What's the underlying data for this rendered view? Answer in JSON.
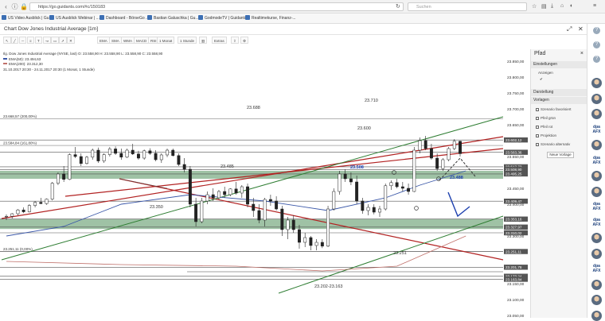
{
  "browser": {
    "url": "https://go.guidants.com/#c/150183",
    "search_placeholder": "Suchen"
  },
  "bookmarks": [
    {
      "label": "US Video Ausblick | Gu..."
    },
    {
      "label": "US Ausblick Webinar | ..."
    },
    {
      "label": "Dashboard - BörseGo ..."
    },
    {
      "label": "Bastian Galuschka | Gu..."
    },
    {
      "label": "GodmodeTV | Guidants"
    },
    {
      "label": "Realtimekurse, Finanz-..."
    }
  ],
  "chart_window": {
    "title": "Chart Dow Jones Industrial Average [1m]"
  },
  "toolbar": {
    "buttons": [
      "EMA",
      "SMA",
      "WMA",
      "MACD",
      "RSI",
      "1 Monat",
      "1 Stunde",
      "Extras"
    ]
  },
  "legend": {
    "line1": "Ilg. Dow Jones Industrial Average (NYSE, last) O: 23.558,90  H: 23.558,90  L: 23.558,90  C: 23.558,90",
    "line2": "EMA(50): 23.494,63",
    "line3": "EMA(200): 23.312,30",
    "line4": "31.10.2017 20:30 - 24.11.2017 20:30 (1 Monat, 1 Stunde)",
    "ema50_color": "#3a57a8",
    "ema200_color": "#c0706a"
  },
  "chart_data": {
    "type": "candlestick",
    "instrument": "Dow Jones Industrial Average",
    "ylim": [
      23050,
      23880
    ],
    "price_ticks": [
      23850,
      23800,
      23750,
      23700,
      23650,
      23600,
      23550,
      23500,
      23450,
      23400,
      23350,
      23300,
      23250,
      23200,
      23150,
      23100,
      23050
    ],
    "level_labels": [
      {
        "value": 23602.12,
        "label": "23.602,12",
        "style": "dark"
      },
      {
        "value": 23563.36,
        "label": "23.563,36",
        "style": "dark"
      },
      {
        "value": 23517.73,
        "label": "23.517,73",
        "style": "dark"
      },
      {
        "value": 23508.9,
        "label": "23.508,90",
        "style": "dark"
      },
      {
        "value": 23495.25,
        "label": "23.495,25",
        "style": "dark"
      },
      {
        "value": 23409.47,
        "label": "23.409,47",
        "style": "dark"
      },
      {
        "value": 23353.16,
        "label": "23.353,16",
        "style": "dark"
      },
      {
        "value": 23327.97,
        "label": "23.327,97",
        "style": "dark"
      },
      {
        "value": 23310.02,
        "label": "23.310,02",
        "style": "dark"
      },
      {
        "value": 23251.11,
        "label": "23.251,11",
        "style": "dark"
      },
      {
        "value": 23201.78,
        "label": "23.201,78",
        "style": "dark"
      },
      {
        "value": 23173.24,
        "label": "23.173,24",
        "style": "dark"
      },
      {
        "value": 23163.84,
        "label": "23.163,84",
        "style": "dark"
      }
    ],
    "fib_levels": [
      {
        "value": 23668.57,
        "label": "23.668,57 (200,00%)"
      },
      {
        "value": 23584.84,
        "label": "23.584,84 (161,80%)"
      },
      {
        "value": 23251.11,
        "label": "23.251,11 (0,00%)"
      }
    ],
    "annotations": [
      "23.688",
      "23.710",
      "23.600",
      "23.485",
      "23.508",
      "23.350",
      "23.488",
      "23.251",
      "23.202-23.163"
    ],
    "support_zones": [
      {
        "from": 23480,
        "to": 23505
      },
      {
        "from": 23322,
        "to": 23353
      }
    ],
    "candles": [
      [
        23360,
        23368,
        23350,
        23362
      ],
      [
        23362,
        23372,
        23355,
        23370
      ],
      [
        23370,
        23385,
        23365,
        23382
      ],
      [
        23382,
        23390,
        23372,
        23376
      ],
      [
        23376,
        23400,
        23374,
        23396
      ],
      [
        23396,
        23410,
        23390,
        23406
      ],
      [
        23406,
        23420,
        23400,
        23402
      ],
      [
        23402,
        23418,
        23398,
        23416
      ],
      [
        23416,
        23470,
        23412,
        23466
      ],
      [
        23466,
        23500,
        23460,
        23495
      ],
      [
        23495,
        23520,
        23470,
        23478
      ],
      [
        23478,
        23560,
        23476,
        23556
      ],
      [
        23556,
        23580,
        23545,
        23550
      ],
      [
        23550,
        23560,
        23520,
        23528
      ],
      [
        23528,
        23552,
        23525,
        23548
      ],
      [
        23548,
        23575,
        23540,
        23570
      ],
      [
        23570,
        23578,
        23530,
        23536
      ],
      [
        23536,
        23560,
        23530,
        23556
      ],
      [
        23556,
        23580,
        23550,
        23574
      ],
      [
        23574,
        23582,
        23555,
        23560
      ],
      [
        23560,
        23575,
        23540,
        23548
      ],
      [
        23548,
        23575,
        23545,
        23570
      ],
      [
        23570,
        23590,
        23555,
        23558
      ],
      [
        23558,
        23568,
        23540,
        23545
      ],
      [
        23545,
        23572,
        23540,
        23568
      ],
      [
        23568,
        23576,
        23555,
        23560
      ],
      [
        23560,
        23570,
        23535,
        23540
      ],
      [
        23540,
        23560,
        23530,
        23555
      ],
      [
        23555,
        23575,
        23548,
        23570
      ],
      [
        23570,
        23575,
        23550,
        23553
      ],
      [
        23553,
        23560,
        23520,
        23525
      ],
      [
        23525,
        23545,
        23500,
        23510
      ],
      [
        23510,
        23520,
        23390,
        23400
      ],
      [
        23400,
        23420,
        23330,
        23345
      ],
      [
        23345,
        23420,
        23340,
        23410
      ],
      [
        23410,
        23440,
        23400,
        23430
      ],
      [
        23430,
        23450,
        23410,
        23420
      ],
      [
        23420,
        23445,
        23415,
        23440
      ],
      [
        23440,
        23455,
        23420,
        23430
      ],
      [
        23430,
        23450,
        23425,
        23448
      ],
      [
        23448,
        23470,
        23430,
        23435
      ],
      [
        23435,
        23460,
        23420,
        23455
      ],
      [
        23455,
        23465,
        23390,
        23400
      ],
      [
        23400,
        23420,
        23360,
        23380
      ],
      [
        23380,
        23400,
        23340,
        23350
      ],
      [
        23350,
        23420,
        23330,
        23415
      ],
      [
        23415,
        23430,
        23395,
        23410
      ],
      [
        23410,
        23425,
        23380,
        23385
      ],
      [
        23385,
        23395,
        23300,
        23320
      ],
      [
        23320,
        23360,
        23290,
        23350
      ],
      [
        23350,
        23365,
        23310,
        23320
      ],
      [
        23320,
        23335,
        23260,
        23280
      ],
      [
        23280,
        23310,
        23265,
        23295
      ],
      [
        23295,
        23300,
        23255,
        23270
      ],
      [
        23270,
        23290,
        23255,
        23280
      ],
      [
        23280,
        23290,
        23262,
        23268
      ],
      [
        23268,
        23395,
        23265,
        23385
      ],
      [
        23385,
        23450,
        23380,
        23440
      ],
      [
        23440,
        23505,
        23430,
        23495
      ],
      [
        23495,
        23510,
        23470,
        23480
      ],
      [
        23480,
        23500,
        23460,
        23470
      ],
      [
        23470,
        23490,
        23400,
        23410
      ],
      [
        23410,
        23420,
        23370,
        23380
      ],
      [
        23380,
        23400,
        23365,
        23390
      ],
      [
        23390,
        23400,
        23368,
        23375
      ],
      [
        23375,
        23395,
        23360,
        23385
      ],
      [
        23385,
        23465,
        23380,
        23458
      ],
      [
        23458,
        23475,
        23445,
        23468
      ],
      [
        23468,
        23480,
        23450,
        23455
      ],
      [
        23455,
        23470,
        23440,
        23450
      ],
      [
        23450,
        23465,
        23430,
        23440
      ],
      [
        23440,
        23580,
        23438,
        23570
      ],
      [
        23570,
        23610,
        23560,
        23600
      ],
      [
        23600,
        23615,
        23570,
        23575
      ],
      [
        23575,
        23590,
        23540,
        23545
      ],
      [
        23545,
        23560,
        23505,
        23512
      ],
      [
        23512,
        23545,
        23505,
        23540
      ],
      [
        23540,
        23580,
        23535,
        23575
      ],
      [
        23575,
        23605,
        23570,
        23598
      ],
      [
        23598,
        23600,
        23550,
        23559
      ]
    ],
    "ema50": [
      [
        0,
        23300
      ],
      [
        10,
        23330
      ],
      [
        20,
        23400
      ],
      [
        32,
        23430
      ],
      [
        45,
        23410
      ],
      [
        56,
        23380
      ],
      [
        66,
        23420
      ],
      [
        72,
        23460
      ],
      [
        80,
        23505
      ]
    ],
    "ema200": [
      [
        0,
        23220
      ],
      [
        20,
        23210
      ],
      [
        40,
        23205
      ],
      [
        55,
        23190
      ],
      [
        68,
        23205
      ],
      [
        80,
        23300
      ]
    ]
  },
  "side_panel": {
    "title": "Pfad",
    "sections": {
      "settings": "Einstellungen",
      "display_label": "Anzeigen",
      "appearance": "Darstellung",
      "templates": "Vorlagen"
    },
    "templates": [
      "Szenario favorisiert",
      "Pfeil grün",
      "Pfeil rot",
      "Projektion",
      "Szenario alternativ"
    ],
    "new_button": "Neue Vorlage",
    "close_label": "×"
  },
  "right_rail": {
    "items": [
      "avatar",
      "avatar",
      "avatar",
      "dpa",
      "avatar",
      "dpa",
      "avatar",
      "avatar",
      "dpa",
      "dpa",
      "avatar",
      "avatar",
      "dpa",
      "avatar",
      "avatar",
      "avatar"
    ],
    "dpa_line1": "dpa",
    "dpa_line2": "AFX"
  },
  "colors": {
    "candle_up": "#ffffff",
    "candle_down": "#222222",
    "support_zone": "#7fae87",
    "trend_red": "#b22222",
    "trend_green": "#2e7d32",
    "price_label_bg": "#555555"
  }
}
